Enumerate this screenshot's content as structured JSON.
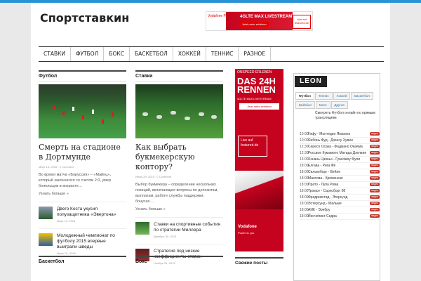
{
  "site": {
    "title": "Спортставкин"
  },
  "banner": {
    "brand": "Vodafone Power to you",
    "headline": "4GLTE MAX LIVESTREAM",
    "cta": "Jetzt mehr erfahren",
    "badge": "Live auf featured.de"
  },
  "nav": {
    "items": [
      "Ставки",
      "Футбол",
      "Бокс",
      "Баскетбол",
      "Хоккей",
      "Теннис",
      "Разное"
    ]
  },
  "col_football": {
    "heading": "Футбол",
    "main": {
      "title": "Смерть на стадионе в Дортмунде",
      "meta": "Март 16, 2016 · 0 Comment",
      "excerpt": "Во время матча «Боруссия» – «Майнц», который закончился со счетом 2:0, умер болельщик в возрасте…",
      "more": "Узнать больше »"
    },
    "items": [
      {
        "title": "Двего Коста укусил полузащитника «Эвертона»",
        "meta": "Март 13, 2016"
      },
      {
        "title": "Молодежный чемпионат по футболу 2015 впервые выиграли шведы",
        "meta": "Июль 01, 2015"
      }
    ]
  },
  "col_bets": {
    "heading": "Ставки",
    "main": {
      "title": "Как выбрать букмекерскую контору?",
      "meta": "Июнь 29, 2015 · 0 Comment",
      "excerpt": "Выбор букмекера – определение нескольких позиций, включающих вопросы по депозитам, выплатам, работе службы поддержки, бонусах…",
      "more": "Узнать больше »"
    },
    "items": [
      {
        "title": "Ставки на спортивные события по стратегии Миллера",
        "meta": "Декабрь 30, 2013"
      },
      {
        "title": "Стратегия под низкие коэффициенты ставок",
        "meta": "Ноябрь 24, 2013"
      }
    ]
  },
  "bottom": {
    "left": "Баскетбол",
    "mid": "Бокс",
    "fresh": "Свежие посты"
  },
  "ad": {
    "top": "ONSPEED ERLEBEN",
    "big": "DAS 24H RENNEN",
    "sub": "4GLTE MAX LIVESTREAM",
    "btn": "Jetzt mehr erfahren",
    "live": "Live auf featured.de",
    "vf": "Vodafone",
    "vf2": "Power to you"
  },
  "widget": {
    "logo": "LEON",
    "tabs": [
      "Футбол",
      "Теннис",
      "Хоккей",
      "Баскетбол",
      "Бейсбол",
      "Мото",
      "Другое"
    ],
    "note": "Смотреть Футбол онлайн по прямым трансляциям",
    "matches": [
      {
        "time": "10:00",
        "name": "Гифу - Монтедио Ямагата",
        "badge": "видео"
      },
      {
        "time": "10:00",
        "name": "Янбянь Фуд - Дзянсу Хувин",
        "badge": "видео"
      },
      {
        "time": "12:30",
        "name": "Сересо Осака - Фаджано Окаяма",
        "badge": "видео"
      },
      {
        "time": "12:30",
        "name": "Россвое Кумамото Матида Дзелвия",
        "badge": "видео"
      },
      {
        "time": "13:00",
        "name": "Хэнань Цзяньэ - Гуанчжоу Фули",
        "badge": "видео"
      },
      {
        "time": "18:00",
        "name": "Елгава - Рига ФК",
        "badge": "видео"
      },
      {
        "time": "18:00",
        "name": "Силькеборг - Вейле",
        "badge": "видео"
      },
      {
        "time": "18:00",
        "name": "Мантова - Кремонезе",
        "badge": "видео"
      },
      {
        "time": "18:00",
        "name": "Прато - Лупа Рома",
        "badge": "видео"
      },
      {
        "time": "18:00",
        "name": "Тромсе - Сарпсборг 08",
        "badge": "видео"
      },
      {
        "time": "18:00",
        "name": "Фредрикстад - Эгерсунд",
        "badge": "видео"
      },
      {
        "time": "18:00",
        "name": "Эстерсунд - Мальме",
        "badge": "видео"
      },
      {
        "time": "18:00",
        "name": "АИК - Эребру",
        "badge": "видео"
      },
      {
        "time": "18:00",
        "name": "Йенчепинг Седра",
        "badge": "видео"
      }
    ]
  }
}
